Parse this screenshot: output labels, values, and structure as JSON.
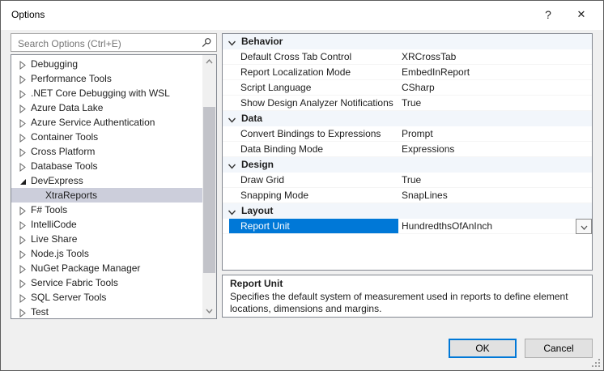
{
  "window": {
    "title": "Options",
    "help_label": "?",
    "close_label": "✕"
  },
  "search": {
    "placeholder": "Search Options (Ctrl+E)"
  },
  "tree": {
    "items": [
      {
        "label": "Debugging",
        "state": "collapsed"
      },
      {
        "label": "Performance Tools",
        "state": "collapsed"
      },
      {
        "label": ".NET Core Debugging with WSL",
        "state": "collapsed"
      },
      {
        "label": "Azure Data Lake",
        "state": "collapsed"
      },
      {
        "label": "Azure Service Authentication",
        "state": "collapsed"
      },
      {
        "label": "Container Tools",
        "state": "collapsed"
      },
      {
        "label": "Cross Platform",
        "state": "collapsed"
      },
      {
        "label": "Database Tools",
        "state": "collapsed"
      },
      {
        "label": "DevExpress",
        "state": "expanded"
      },
      {
        "label": "XtraReports",
        "state": "child-selected"
      },
      {
        "label": "F# Tools",
        "state": "collapsed"
      },
      {
        "label": "IntelliCode",
        "state": "collapsed"
      },
      {
        "label": "Live Share",
        "state": "collapsed"
      },
      {
        "label": "Node.js Tools",
        "state": "collapsed"
      },
      {
        "label": "NuGet Package Manager",
        "state": "collapsed"
      },
      {
        "label": "Service Fabric Tools",
        "state": "collapsed"
      },
      {
        "label": "SQL Server Tools",
        "state": "collapsed"
      },
      {
        "label": "Test",
        "state": "collapsed"
      }
    ]
  },
  "grid": {
    "rows": [
      {
        "label": "Behavior"
      },
      {
        "name": "Default Cross Tab Control",
        "value": "XRCrossTab"
      },
      {
        "name": "Report Localization Mode",
        "value": "EmbedInReport"
      },
      {
        "name": "Script Language",
        "value": "CSharp"
      },
      {
        "name": "Show Design Analyzer Notifications",
        "value": "True"
      },
      {
        "label": "Data"
      },
      {
        "name": "Convert Bindings to Expressions",
        "value": "Prompt"
      },
      {
        "name": "Data Binding Mode",
        "value": "Expressions"
      },
      {
        "label": "Design"
      },
      {
        "name": "Draw Grid",
        "value": "True"
      },
      {
        "name": "Snapping Mode",
        "value": "SnapLines"
      },
      {
        "label": "Layout"
      },
      {
        "name": "Report Unit",
        "value": "HundredthsOfAnInch",
        "selected": true,
        "has_dropdown": true
      }
    ]
  },
  "description": {
    "title": "Report Unit",
    "text": "Specifies the default system of measurement used in reports to define element locations, dimensions and margins."
  },
  "buttons": {
    "ok": "OK",
    "cancel": "Cancel"
  },
  "colors": {
    "accent": "#0078d7",
    "tree_selection_inactive": "#cccedb",
    "category_row_bg": "#f2f6fb",
    "dialog_bg": "#f0f0f0"
  }
}
